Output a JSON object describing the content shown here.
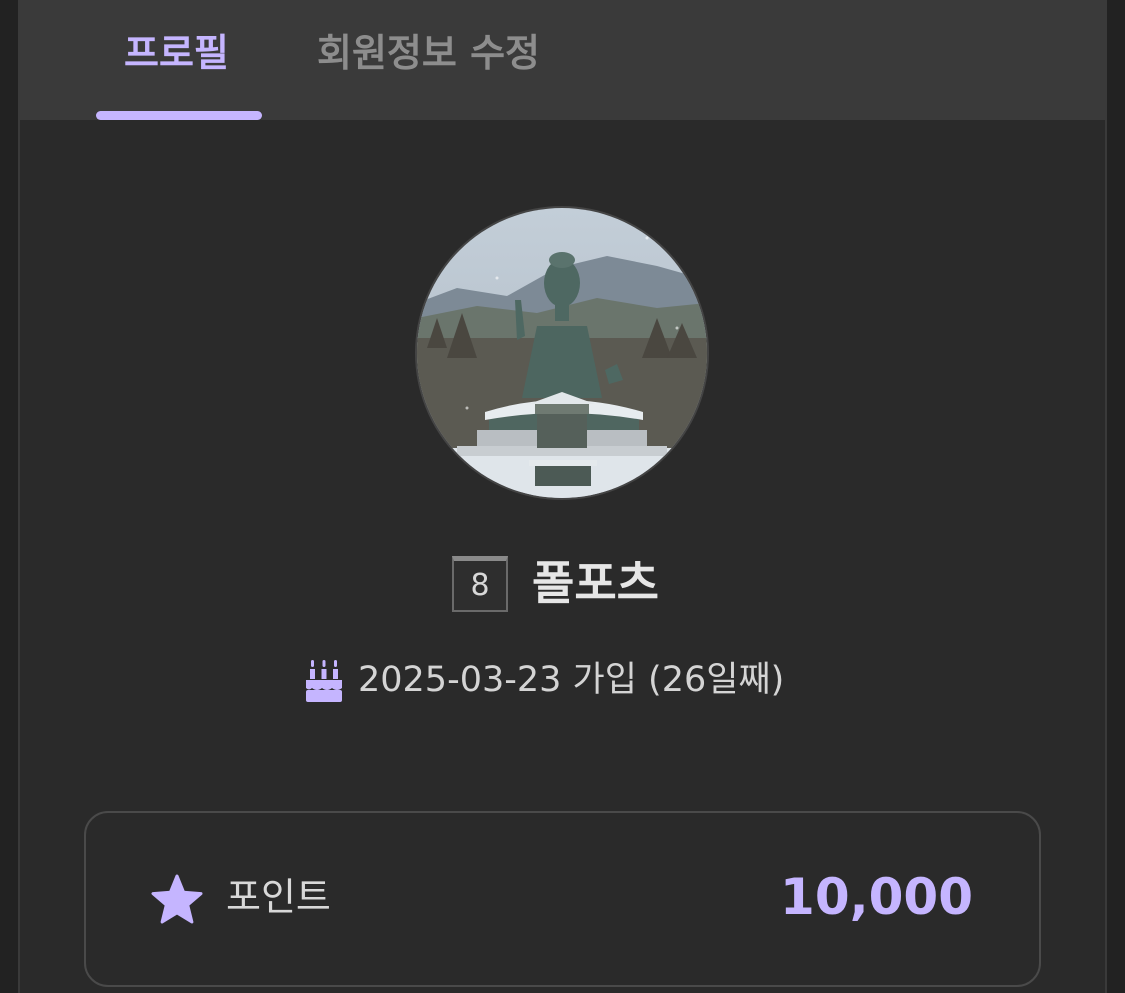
{
  "tabs": {
    "profile_label": "프로필",
    "edit_label": "회원정보 수정"
  },
  "profile": {
    "level": "8",
    "nickname": "폴포츠",
    "join_text": "2025-03-23 가입 (26일째)"
  },
  "points": {
    "label": "포인트",
    "value": "10,000"
  },
  "icons": {
    "join": "cake-icon",
    "points": "star-icon"
  },
  "colors": {
    "accent": "#c5b5ff",
    "background": "#2a2a2a",
    "tabbar": "#3a3a3a",
    "inactive_tab": "#8d8d8d"
  }
}
